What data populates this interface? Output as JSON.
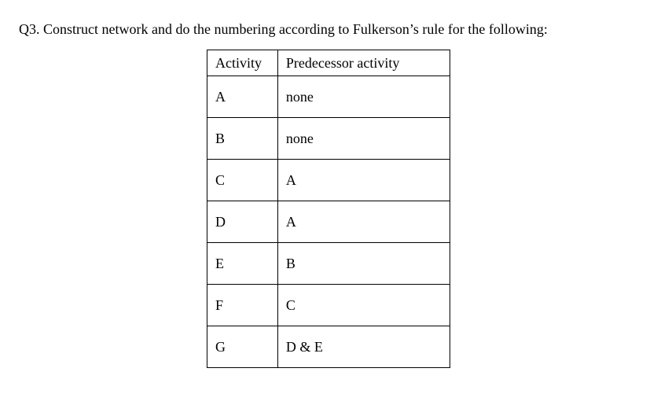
{
  "question": "Q3. Construct network and do the numbering according to Fulkerson’s rule for the following:",
  "table": {
    "headers": [
      "Activity",
      "Predecessor activity"
    ],
    "rows": [
      {
        "activity": "A",
        "predecessor": "none"
      },
      {
        "activity": "B",
        "predecessor": "none"
      },
      {
        "activity": "C",
        "predecessor": "A"
      },
      {
        "activity": "D",
        "predecessor": "A"
      },
      {
        "activity": "E",
        "predecessor": "B"
      },
      {
        "activity": "F",
        "predecessor": "C"
      },
      {
        "activity": "G",
        "predecessor": "D & E"
      }
    ]
  }
}
